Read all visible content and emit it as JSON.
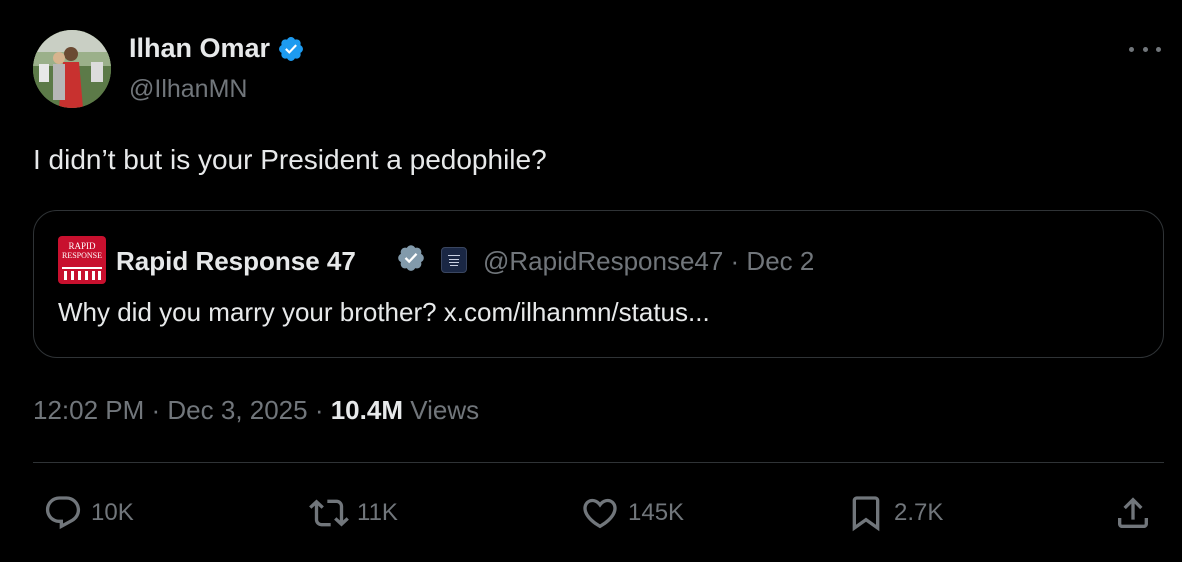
{
  "author": {
    "display_name": "Ilhan Omar",
    "handle": "@IlhanMN"
  },
  "tweet": {
    "text": "I didn’t but is your President a pedophile?"
  },
  "quote": {
    "logo_text_line1": "RAPID",
    "logo_text_line2": "RESPONSE",
    "display_name": "Rapid Response 47",
    "affiliate_badge_text": "THE WHITE HOUSE",
    "meta": "@RapidResponse47 · Dec 2",
    "text": "Why did you marry your brother? x.com/ilhanmn/status..."
  },
  "timestamp": {
    "time_date": "12:02 PM · Dec 3, 2025 · ",
    "views_count": "10.4M",
    "views_label": " Views"
  },
  "actions": {
    "replies": "10K",
    "reposts": "11K",
    "likes": "145K",
    "bookmarks": "2.7K"
  },
  "colors": {
    "background": "#000000",
    "primary_text": "#e7e9ea",
    "secondary_text": "#71767b",
    "border": "#2f3336",
    "verified_blue": "#1d9bf0",
    "verified_gray": "#829aab",
    "quote_logo_red": "#c8102e"
  },
  "icons": [
    "verified-badge-icon",
    "more-options-icon",
    "reply-icon",
    "repost-icon",
    "like-icon",
    "bookmark-icon",
    "share-icon"
  ]
}
